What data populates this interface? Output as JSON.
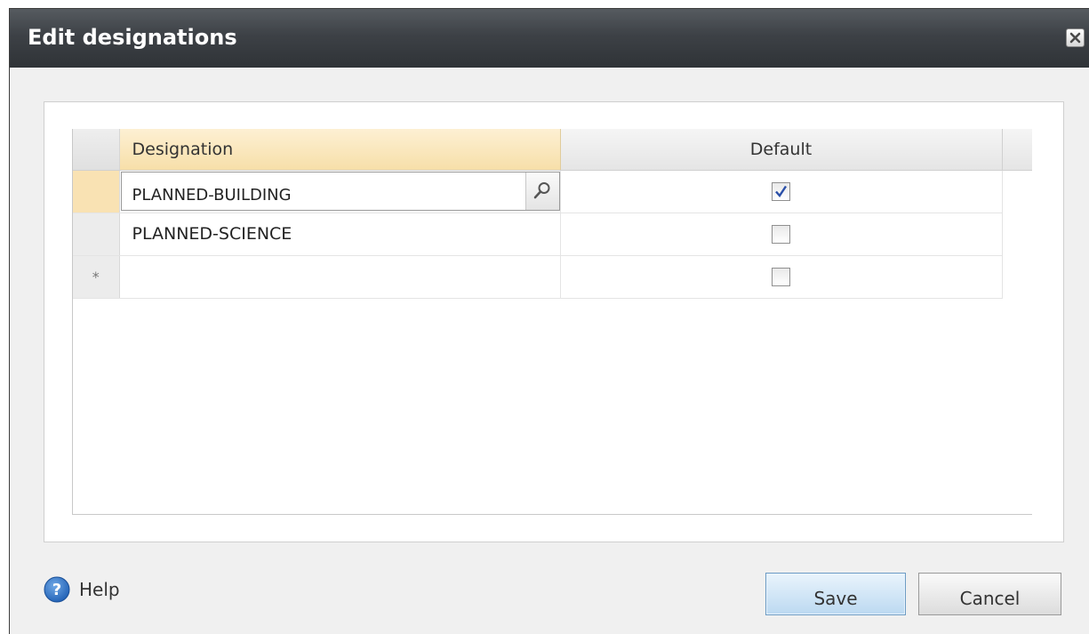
{
  "dialog": {
    "title": "Edit designations",
    "close_icon": "close-icon"
  },
  "grid": {
    "columns": [
      "Designation",
      "Default"
    ],
    "rows": [
      {
        "designation": "PLANNED-BUILDING",
        "default": true,
        "active": true
      },
      {
        "designation": "PLANNED-SCIENCE",
        "default": false,
        "active": false
      }
    ],
    "new_row_marker": "*"
  },
  "footer": {
    "help_label": "Help",
    "help_icon": "help-icon",
    "save_label": "Save",
    "cancel_label": "Cancel"
  },
  "colors": {
    "titlebar": "#3d4146",
    "header_active": "#f7dfa9",
    "save_button": "#bcd9f1"
  }
}
